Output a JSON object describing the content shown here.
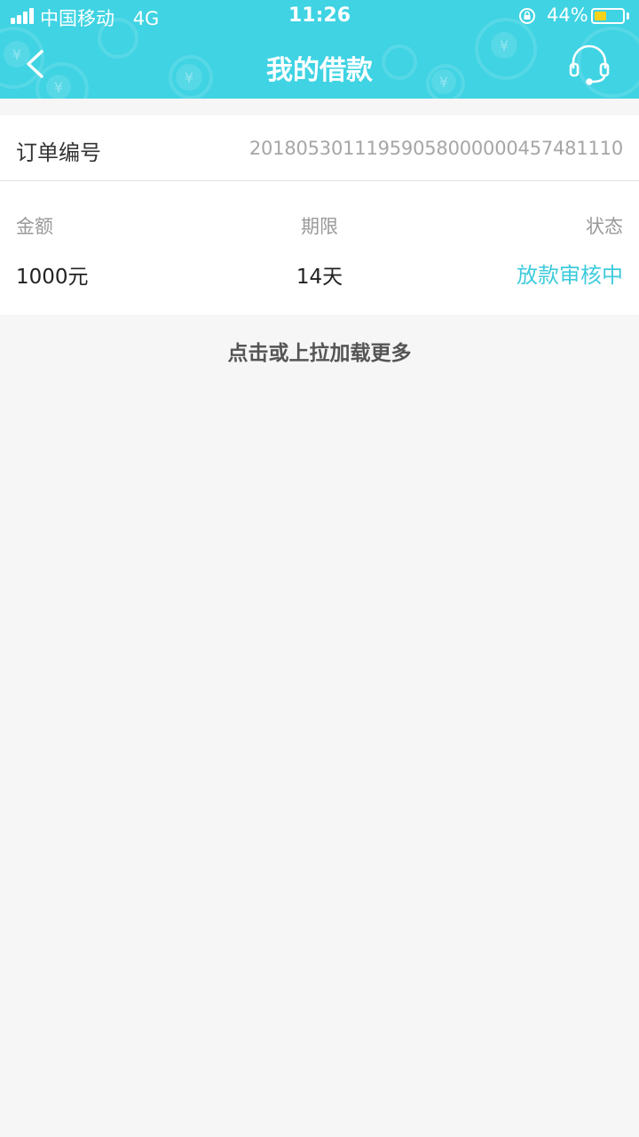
{
  "status_bar": {
    "carrier": "中国移动",
    "network": "4G",
    "time": "11:26",
    "battery_percent": "44%",
    "battery_level": 0.44,
    "battery_color": "#f6d21a"
  },
  "header": {
    "title": "我的借款",
    "back_icon": "chevron-left-icon",
    "support_icon": "headset-icon",
    "background_color": "#3fd3e3"
  },
  "order": {
    "label": "订单编号",
    "number": "20180530111959058000000457481110"
  },
  "loan": {
    "amount_label": "金额",
    "term_label": "期限",
    "status_label": "状态",
    "amount": "1000元",
    "term": "14天",
    "status": "放款审核中",
    "status_color": "#3fcbdc"
  },
  "load_more": "点击或上拉加载更多"
}
